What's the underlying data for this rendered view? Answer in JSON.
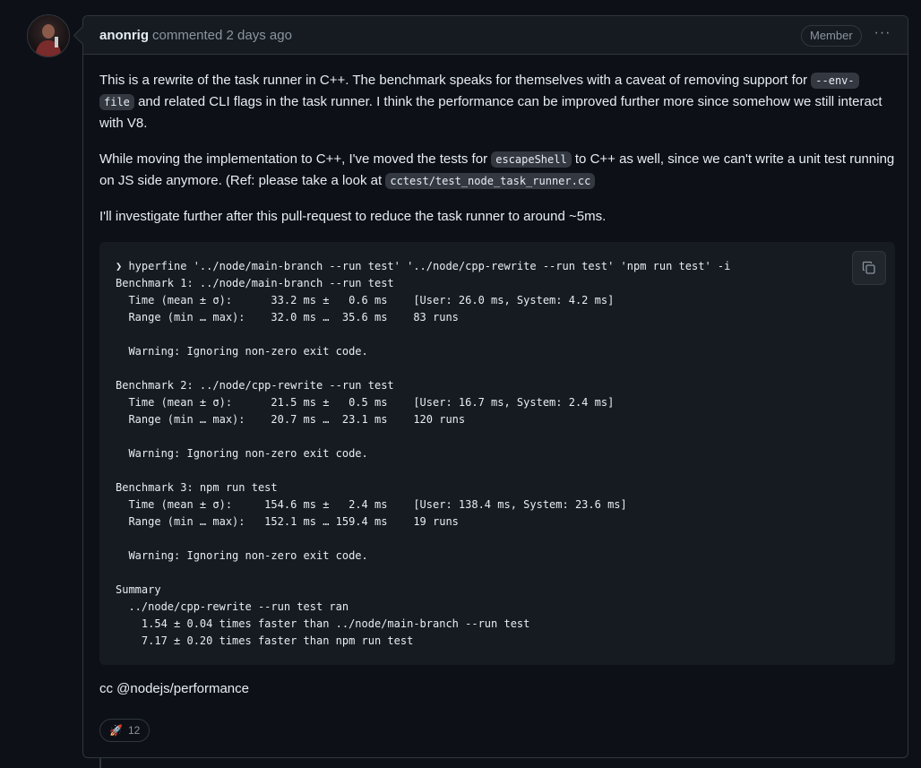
{
  "comment": {
    "author": "anonrig",
    "meta": "commented 2 days ago",
    "badge": "Member",
    "menu_glyph": "···"
  },
  "body": {
    "p1_a": "This is a rewrite of the task runner in C++. The benchmark speaks for themselves with a caveat of removing support for ",
    "p1_code1a": "--env-",
    "p1_code1b": "file",
    "p1_b": " and related CLI flags in the task runner. I think the performance can be improved further more since somehow we still interact with V8.",
    "p2_a": "While moving the implementation to C++, I've moved the tests for ",
    "p2_code1": "escapeShell",
    "p2_b": " to C++ as well, since we can't write a unit test running on JS side anymore. (Ref: please take a look at ",
    "p2_code2": "cctest/test_node_task_runner.cc",
    "p3": "I'll investigate further after this pull-request to reduce the task runner to around ~5ms."
  },
  "code": {
    "text": "❯ hyperfine '../node/main-branch --run test' '../node/cpp-rewrite --run test' 'npm run test' -i\nBenchmark 1: ../node/main-branch --run test\n  Time (mean ± σ):      33.2 ms ±   0.6 ms    [User: 26.0 ms, System: 4.2 ms]\n  Range (min … max):    32.0 ms …  35.6 ms    83 runs\n\n  Warning: Ignoring non-zero exit code.\n\nBenchmark 2: ../node/cpp-rewrite --run test\n  Time (mean ± σ):      21.5 ms ±   0.5 ms    [User: 16.7 ms, System: 2.4 ms]\n  Range (min … max):    20.7 ms …  23.1 ms    120 runs\n\n  Warning: Ignoring non-zero exit code.\n\nBenchmark 3: npm run test\n  Time (mean ± σ):     154.6 ms ±   2.4 ms    [User: 138.4 ms, System: 23.6 ms]\n  Range (min … max):   152.1 ms … 159.4 ms    19 runs\n\n  Warning: Ignoring non-zero exit code.\n\nSummary\n  ../node/cpp-rewrite --run test ran\n    1.54 ± 0.04 times faster than ../node/main-branch --run test\n    7.17 ± 0.20 times faster than npm run test"
  },
  "footer": {
    "cc": "cc @nodejs/performance"
  },
  "reaction": {
    "emoji": "🚀",
    "count": "12"
  },
  "colors": {
    "background": "#0d1117",
    "surface": "#161b22",
    "border": "#30363d",
    "text": "#e6edf3",
    "muted": "#8b949e"
  }
}
